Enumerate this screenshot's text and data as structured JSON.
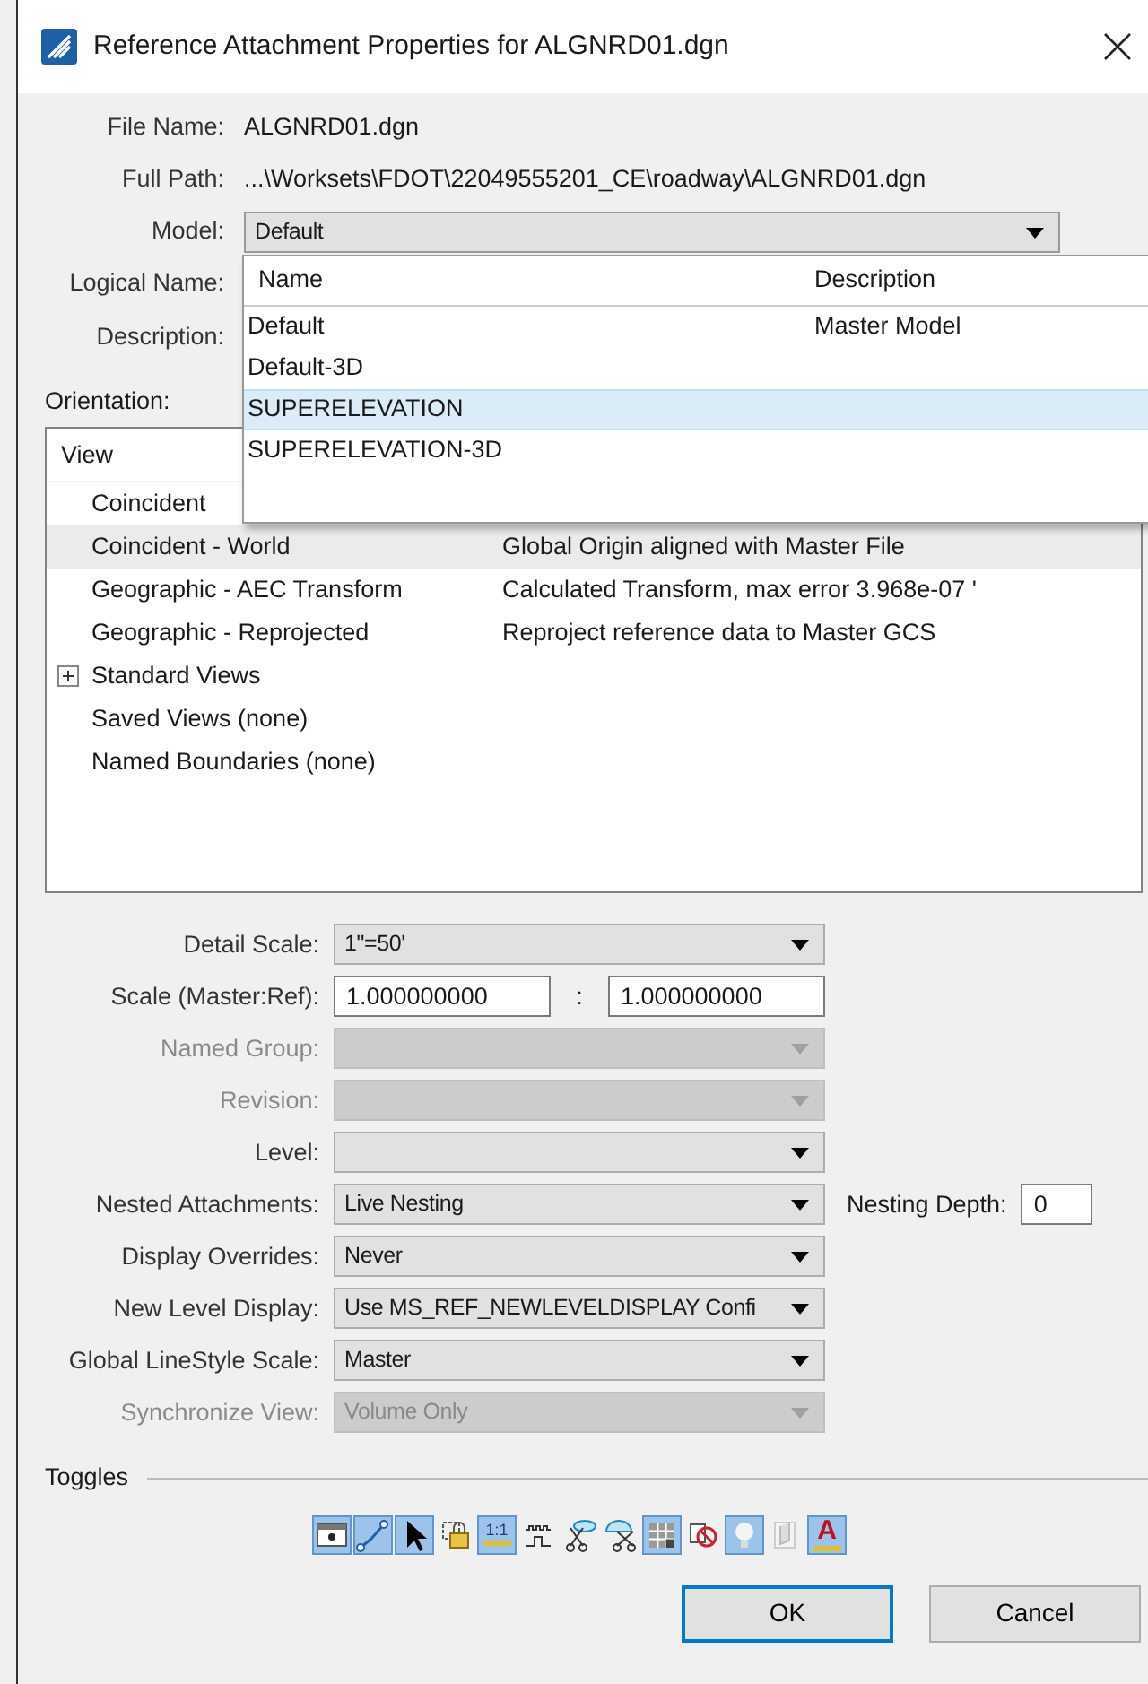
{
  "window": {
    "title": "Reference Attachment Properties for ALGNRD01.dgn"
  },
  "file_name": {
    "label": "File Name:",
    "value": "ALGNRD01.dgn"
  },
  "full_path": {
    "label": "Full Path:",
    "value": "...\\Worksets\\FDOT\\22049555201_CE\\roadway\\ALGNRD01.dgn"
  },
  "model": {
    "label": "Model:",
    "value": "Default",
    "expanded": true
  },
  "model_popup": {
    "columns": [
      "Name",
      "Description"
    ],
    "rows": [
      {
        "name": "Default",
        "description": "Master Model",
        "selected": false
      },
      {
        "name": "Default-3D",
        "selected": false
      },
      {
        "name": "SUPERELEVATION",
        "selected": true
      },
      {
        "name": "SUPERELEVATION-3D",
        "selected": false
      }
    ]
  },
  "logical_name": {
    "label": "Logical Name:"
  },
  "description": {
    "label": "Description:"
  },
  "orientation": {
    "label": "Orientation:",
    "column": "View",
    "rows": [
      {
        "view": "Coincident",
        "description": "",
        "selected": false,
        "expandable": false
      },
      {
        "view": "Coincident - World",
        "description": "Global Origin aligned with Master File",
        "selected": true,
        "expandable": false
      },
      {
        "view": "Geographic - AEC Transform",
        "description": "Calculated Transform, max error 3.968e-07 '",
        "selected": false,
        "expandable": false
      },
      {
        "view": "Geographic - Reprojected",
        "description": "Reproject reference data to Master GCS",
        "selected": false,
        "expandable": false
      },
      {
        "view": "Standard Views",
        "selected": false,
        "expandable": true,
        "expanded": false
      },
      {
        "view": "Saved Views (none)",
        "selected": false,
        "expandable": false
      },
      {
        "view": "Named Boundaries (none)",
        "selected": false,
        "expandable": false
      }
    ]
  },
  "settings": [
    {
      "kind": "dropdown",
      "label": "Detail Scale:",
      "value": "1\"=50'",
      "disabled": false
    },
    {
      "kind": "ratio",
      "label": "Scale (Master:Ref):",
      "value": "1.000000000",
      "separator": ":",
      "value2": "1.000000000",
      "disabled": false
    },
    {
      "kind": "dropdown",
      "label": "Named Group:",
      "disabled": true
    },
    {
      "kind": "dropdown",
      "label": "Revision:",
      "disabled": true
    },
    {
      "kind": "dropdown",
      "label": "Level:",
      "disabled": false
    },
    {
      "kind": "dropdown",
      "label": "Nested Attachments:",
      "value": "Live Nesting",
      "disabled": false,
      "extra_label": "Nesting Depth:",
      "extra_value": "0"
    },
    {
      "kind": "dropdown",
      "label": "Display Overrides:",
      "value": "Never",
      "disabled": false
    },
    {
      "kind": "dropdown",
      "label": "New Level Display:",
      "value": "Use MS_REF_NEWLEVELDISPLAY Confi",
      "disabled": false
    },
    {
      "kind": "dropdown",
      "label": "Global LineStyle Scale:",
      "value": "Master",
      "disabled": false
    },
    {
      "kind": "dropdown",
      "label": "Synchronize View:",
      "value": "Volume Only",
      "disabled": true
    }
  ],
  "toggles": {
    "label": "Toggles",
    "items": [
      {
        "kind": "display",
        "on": true
      },
      {
        "kind": "snap",
        "on": true
      },
      {
        "kind": "locate",
        "on": true
      },
      {
        "kind": "lock",
        "on": false
      },
      {
        "kind": "scale",
        "on": true,
        "glyph": "1:1"
      },
      {
        "kind": "line-style",
        "on": false
      },
      {
        "kind": "clip-front",
        "on": false
      },
      {
        "kind": "clip-back",
        "on": false
      },
      {
        "kind": "raster",
        "on": true
      },
      {
        "kind": "ignore",
        "on": false
      },
      {
        "kind": "bulb",
        "on": true
      },
      {
        "kind": "door",
        "on": false
      },
      {
        "kind": "text",
        "on": true,
        "glyph": "A"
      }
    ]
  },
  "buttons": [
    "OK",
    "Cancel"
  ]
}
